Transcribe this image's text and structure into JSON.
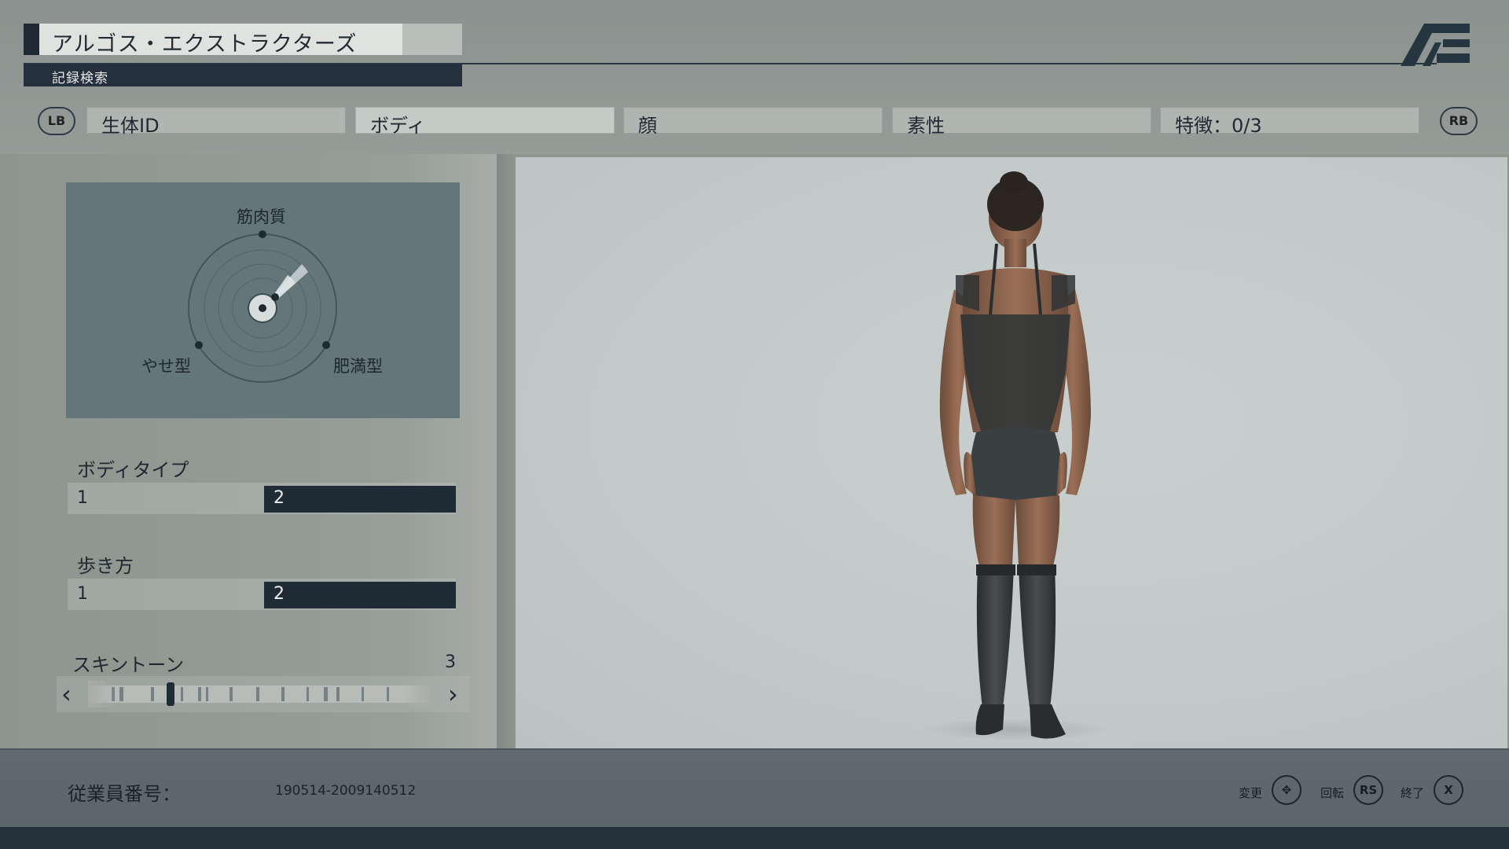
{
  "header": {
    "title": "アルゴス・エクストラクターズ",
    "subtitle": "記録検索",
    "logo_icon": "ae-logo-icon"
  },
  "tabs": {
    "left_button": "LB",
    "right_button": "RB",
    "items": [
      {
        "label": "生体ID"
      },
      {
        "label": "ボディ"
      },
      {
        "label": "顔"
      },
      {
        "label": "素性"
      },
      {
        "label": "特徴：0/3"
      }
    ],
    "active_index": 1
  },
  "body_chart": {
    "top_label": "筋肉質",
    "left_label": "やせ型",
    "right_label": "肥満型"
  },
  "body_type": {
    "label": "ボディタイプ",
    "options": [
      "1",
      "2"
    ],
    "selected": "2"
  },
  "walk_style": {
    "label": "歩き方",
    "options": [
      "1",
      "2"
    ],
    "selected": "2"
  },
  "skin_tone": {
    "label": "スキントーン",
    "value": "3",
    "prev_icon": "chevron-left-icon",
    "next_icon": "chevron-right-icon"
  },
  "footer": {
    "employee_label": "従業員番号：",
    "employee_number": "190514-2009140512",
    "hints": [
      {
        "label": "変更",
        "button": "✥",
        "icon": "dpad-icon"
      },
      {
        "label": "回転",
        "button": "RS",
        "icon": "rs-stick-icon"
      },
      {
        "label": "終了",
        "button": "X",
        "icon": "x-button-icon"
      }
    ]
  },
  "colors": {
    "dark_accent": "#1f2b35",
    "panel": "#65767a",
    "preview_bg": "#c3c9c9",
    "footer": "#5f6a6c"
  }
}
